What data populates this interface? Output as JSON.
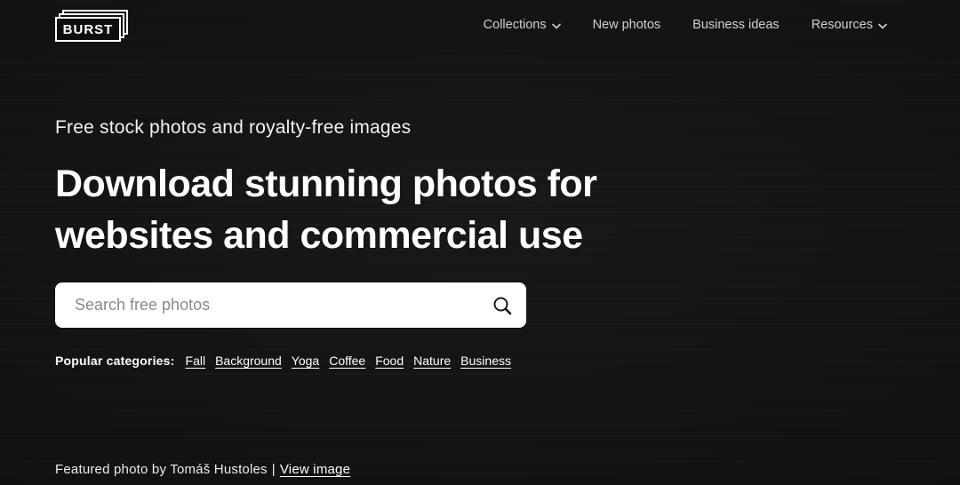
{
  "brand": {
    "logo_text": "BURST"
  },
  "nav": {
    "items": [
      {
        "label": "Collections",
        "has_dropdown": true
      },
      {
        "label": "New photos",
        "has_dropdown": false
      },
      {
        "label": "Business ideas",
        "has_dropdown": false
      },
      {
        "label": "Resources",
        "has_dropdown": true
      }
    ]
  },
  "hero": {
    "subtitle": "Free stock photos and royalty-free images",
    "title_line1": "Download stunning photos for",
    "title_line2": "websites and commercial use",
    "search": {
      "placeholder": "Search free photos",
      "value": "",
      "icon": "search-icon"
    },
    "categories_label": "Popular categories:",
    "categories": [
      "Fall",
      "Background",
      "Yoga",
      "Coffee",
      "Food",
      "Nature",
      "Business"
    ]
  },
  "footer": {
    "credit_prefix": "Featured photo by Tomáš Hustoles",
    "separator": "|",
    "view_image_label": "View image"
  },
  "colors": {
    "background": "#121212",
    "nav_text": "#d0d0d0",
    "heading": "#ffffff",
    "search_placeholder": "#8a8a8a",
    "search_background": "#ffffff"
  }
}
